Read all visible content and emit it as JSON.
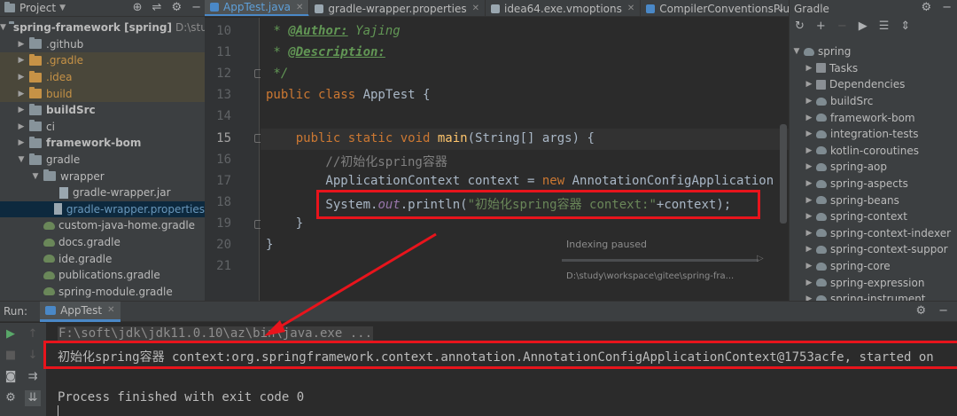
{
  "project": {
    "title": "Project",
    "tree": [
      {
        "label": "spring-framework [spring]",
        "suffix": "D:\\study",
        "type": "root"
      },
      {
        "label": ".github",
        "type": "folder"
      },
      {
        "label": ".gradle",
        "type": "folder-orange"
      },
      {
        "label": ".idea",
        "type": "folder-orange"
      },
      {
        "label": "build",
        "type": "folder-orange"
      },
      {
        "label": "buildSrc",
        "type": "folder-bold"
      },
      {
        "label": "ci",
        "type": "folder"
      },
      {
        "label": "framework-bom",
        "type": "folder-bold"
      },
      {
        "label": "gradle",
        "type": "folder"
      },
      {
        "label": "wrapper",
        "type": "folder"
      },
      {
        "label": "gradle-wrapper.jar",
        "type": "file"
      },
      {
        "label": "gradle-wrapper.properties",
        "type": "file-sel"
      },
      {
        "label": "custom-java-home.gradle",
        "type": "gradle"
      },
      {
        "label": "docs.gradle",
        "type": "gradle"
      },
      {
        "label": "ide.gradle",
        "type": "gradle"
      },
      {
        "label": "publications.gradle",
        "type": "gradle"
      },
      {
        "label": "spring-module.gradle",
        "type": "gradle"
      }
    ]
  },
  "editor": {
    "tabs": [
      {
        "label": "AppTest.java",
        "active": true,
        "color": "#4a88c7"
      },
      {
        "label": "gradle-wrapper.properties",
        "active": false,
        "color": "#9aa7b0"
      },
      {
        "label": "idea64.exe.vmoptions",
        "active": false,
        "color": "#9aa7b0"
      },
      {
        "label": "CompilerConventionsPlug",
        "active": false,
        "color": "#4a88c7"
      }
    ],
    "line_numbers": [
      "10",
      "11",
      "12",
      "13",
      "14",
      "15",
      "16",
      "17",
      "18",
      "19",
      "20",
      "21"
    ],
    "code": {
      "l10_prefix": " * ",
      "l10_tag": "@Author:",
      "l10_val": " Yajing",
      "l11_prefix": " * ",
      "l11_tag": "@Description:",
      "l12": " */",
      "l13_kw": "public class ",
      "l13_rest": "AppTest {",
      "l15_kw": "    public static void ",
      "l15_fn": "main",
      "l15_rest": "(String[] args) {",
      "l16": "        //初始化spring容器",
      "l17_a": "        ApplicationContext context = ",
      "l17_kw": "new ",
      "l17_b": "AnnotationConfigApplication",
      "l18_a": "        System.",
      "l18_b": "out",
      "l18_c": ".println(",
      "l18_str": "\"初始化spring容器 context:\"",
      "l18_d": "+context);",
      "l19": "    }",
      "l20": "}"
    },
    "indexing": {
      "status": "Indexing paused",
      "path": "D:\\study\\workspace\\gitee\\spring-fra..."
    }
  },
  "gradle": {
    "title": "Gradle",
    "tree": [
      {
        "label": "spring",
        "type": "root"
      },
      {
        "label": "Tasks",
        "type": "tasks"
      },
      {
        "label": "Dependencies",
        "type": "tasks"
      },
      {
        "label": "buildSrc",
        "type": "mod"
      },
      {
        "label": "framework-bom",
        "type": "mod"
      },
      {
        "label": "integration-tests",
        "type": "mod"
      },
      {
        "label": "kotlin-coroutines",
        "type": "mod"
      },
      {
        "label": "spring-aop",
        "type": "mod"
      },
      {
        "label": "spring-aspects",
        "type": "mod"
      },
      {
        "label": "spring-beans",
        "type": "mod"
      },
      {
        "label": "spring-context",
        "type": "mod"
      },
      {
        "label": "spring-context-indexer",
        "type": "mod"
      },
      {
        "label": "spring-context-suppor",
        "type": "mod"
      },
      {
        "label": "spring-core",
        "type": "mod"
      },
      {
        "label": "spring-expression",
        "type": "mod"
      },
      {
        "label": "spring-instrument",
        "type": "mod"
      }
    ]
  },
  "run": {
    "label": "Run:",
    "tab": "AppTest",
    "console": {
      "cmd": "F:\\soft\\jdk\\jdk11.0.10\\az\\bin\\java.exe ...",
      "output": "初始化spring容器 context:org.springframework.context.annotation.AnnotationConfigApplicationContext@1753acfe, started on",
      "exit": "Process finished with exit code 0"
    }
  },
  "annotations": {
    "color": "#e8141c"
  }
}
